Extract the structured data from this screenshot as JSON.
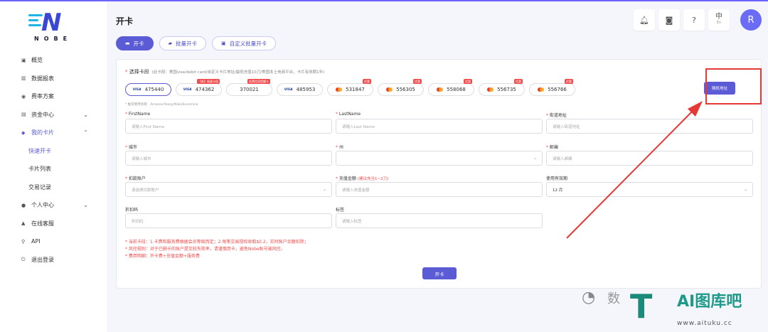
{
  "brand": {
    "logo_text": "NOBE",
    "logo_letter": "N"
  },
  "sidebar": {
    "items": [
      {
        "label": "概览",
        "icon": "dashboard-icon"
      },
      {
        "label": "数据报表",
        "icon": "chart-icon"
      },
      {
        "label": "费率方案",
        "icon": "rate-icon"
      },
      {
        "label": "资金中心",
        "icon": "wallet-icon"
      },
      {
        "label": "我的卡片",
        "icon": "card-icon"
      },
      {
        "label": "快速开卡"
      },
      {
        "label": "卡片列表"
      },
      {
        "label": "交易记录"
      },
      {
        "label": "个人中心",
        "icon": "user-icon"
      },
      {
        "label": "在线客服",
        "icon": "support-icon"
      },
      {
        "label": "API",
        "icon": "api-icon"
      },
      {
        "label": "退出登录",
        "icon": "logout-icon"
      }
    ]
  },
  "header": {
    "title": "开卡",
    "lang_main": "中",
    "lang_sub": "En",
    "avatar": "R"
  },
  "tabs": [
    {
      "label": "开卡"
    },
    {
      "label": "批量开卡"
    },
    {
      "label": "自定义批量开卡"
    }
  ],
  "form": {
    "select_label": "选择卡段",
    "select_hint": "(此卡段：美国visa/debit card/自定义卡片地址/最低充值10刀/美国本土电商平台，卡片有效期1年)",
    "bins": [
      {
        "number": "475440",
        "brand": "VISA",
        "badge": ""
      },
      {
        "number": "474362",
        "brand": "VISA",
        "badge": "【新】极速卡段"
      },
      {
        "number": "370021",
        "brand": "",
        "badge": "低费信息提醒卡"
      },
      {
        "number": "485953",
        "brand": "VISA",
        "badge": ""
      },
      {
        "number": "531847",
        "brand": "MC",
        "badge": "优惠"
      },
      {
        "number": "556305",
        "brand": "MC",
        "badge": "优惠"
      },
      {
        "number": "558068",
        "brand": "MC",
        "badge": "优惠"
      },
      {
        "number": "556735",
        "brand": "MC",
        "badge": "优惠"
      },
      {
        "number": "556766",
        "brand": "MC",
        "badge": "优惠"
      }
    ],
    "usage": "* 推荐使用场景：Amazon/Yeezy/Nike/Scanmine",
    "random_button": "随机地址",
    "fields": {
      "firstname": {
        "label": "FirstName",
        "placeholder": "请输入First Name"
      },
      "lastname": {
        "label": "LastName",
        "placeholder": "请输入Last Name"
      },
      "address": {
        "label": "街道地址",
        "placeholder": "请输入街道地址"
      },
      "city": {
        "label": "城市",
        "placeholder": "请输入城市"
      },
      "state": {
        "label": "州",
        "placeholder": ""
      },
      "zip": {
        "label": "邮编",
        "placeholder": "请输入邮编"
      },
      "account": {
        "label": "扣款账户",
        "placeholder": "请选择扣款账户"
      },
      "amount": {
        "label": "充值金额",
        "note": "(建议充当1~2刀)",
        "placeholder": "请输入充值金额"
      },
      "validity": {
        "label": "使用有效期",
        "value": "12 月"
      },
      "discount": {
        "label": "折扣码",
        "placeholder": "折扣码"
      },
      "tag": {
        "label": "标签",
        "placeholder": "请输入标签"
      }
    },
    "notes": [
      "* 当前卡段：1.卡费和服务费根据会员等级而定；2.每笔交易授权收取$0.2，实时账户余额扣除；",
      "* 风控规则：对于已删卡的账户提交较失败率，请谨慎用卡，避免Nobe账号被风控。",
      "* 费用明细：开卡费+充值金额+服务费"
    ],
    "submit": "开卡"
  },
  "watermark": {
    "title": "AI图库吧",
    "url": "www.aituku.cc",
    "partial": "数"
  },
  "colors": {
    "accent": "#5b5bd6",
    "danger": "#f04a4a",
    "annotation": "#e53935"
  }
}
